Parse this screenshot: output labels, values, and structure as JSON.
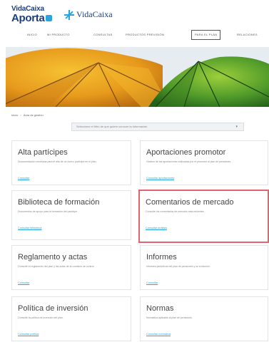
{
  "brand": {
    "line1": "VidaCaixa",
    "line2": "Aporta"
  },
  "partner": {
    "name": "VidaCaixa"
  },
  "nav": {
    "items": [
      "INICIO",
      "MI PRODUCTO",
      "CONSULTAS",
      "PRODUCTOS PREVISIÓN",
      "PARA EL PLAN",
      "RELACIONES"
    ],
    "active_index": 4
  },
  "hero": {
    "image": "umbrellas-banner"
  },
  "breadcrumb": {
    "home": "Inicio",
    "current": "Área de gestión"
  },
  "search": {
    "placeholder": "Seleccione el filtro de que quiere conocer la información",
    "caret_icon": "chevron-down-icon"
  },
  "cards": [
    {
      "title": "Alta partícipes",
      "desc": "Documentación necesaria para el alta de un nuevo partícipe en el plan.",
      "link": "Consultar"
    },
    {
      "title": "Aportaciones promotor",
      "desc": "Gestión de las aportaciones realizadas por el promotor al plan de pensiones.",
      "link": "Consultar aportaciones"
    },
    {
      "title": "Biblioteca de formación",
      "desc": "Documentos de apoyo para la formación del partícipe.",
      "link": "Consultar biblioteca"
    },
    {
      "title": "Comentarios de mercado",
      "desc": "Consulte los comentarios de mercado más recientes.",
      "link": "Consultar análisis"
    },
    {
      "title": "Reglamento y actas",
      "desc": "Consulte el reglamento del plan y las actas de la comisión de control.",
      "link": "Consultar"
    },
    {
      "title": "Informes",
      "desc": "Informes periódicos del plan de pensiones y su evolución.",
      "link": "Consultar"
    },
    {
      "title": "Política de inversión",
      "desc": "Consulte la política de inversión del plan.",
      "link": "Consultar política"
    },
    {
      "title": "Normas",
      "desc": "Normativa aplicable al plan de pensiones.",
      "link": "Consultar normativa"
    }
  ],
  "colors": {
    "brand": "#1c3f7a",
    "accent": "#2aa6df",
    "highlight": "#e0646d"
  }
}
